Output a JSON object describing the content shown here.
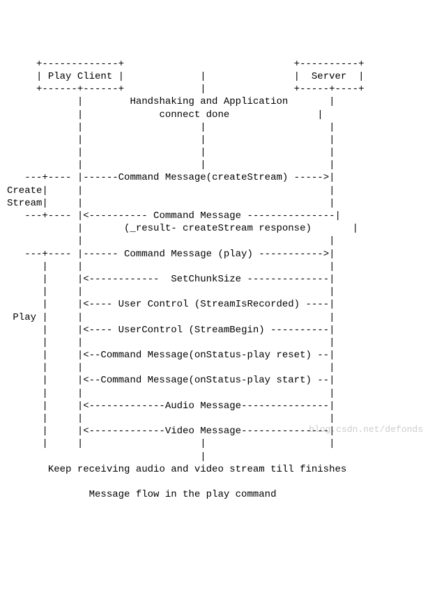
{
  "boxes": {
    "client": "Play Client",
    "server": "Server"
  },
  "phases": {
    "handshake": "Handshaking and Application",
    "handshake2": "connect done"
  },
  "sections": {
    "create": "Create",
    "stream": "Stream",
    "play": "Play"
  },
  "messages": {
    "m1": "Command Message(createStream)",
    "m2": "Command Message",
    "m2b": "(_result- createStream response)",
    "m3": "Command Message (play)",
    "m4": "SetChunkSize",
    "m5": "User Control (StreamIsRecorded)",
    "m6": "UserControl (StreamBegin)",
    "m7": "Command Message(onStatus-play reset)",
    "m8": "Command Message(onStatus-play start)",
    "m9": "Audio Message",
    "m10": "Video Message"
  },
  "footer": {
    "line1": "Keep receiving audio and video stream till finishes",
    "line2": "Message flow in the play command"
  },
  "watermark": "blog.csdn.net/defonds"
}
